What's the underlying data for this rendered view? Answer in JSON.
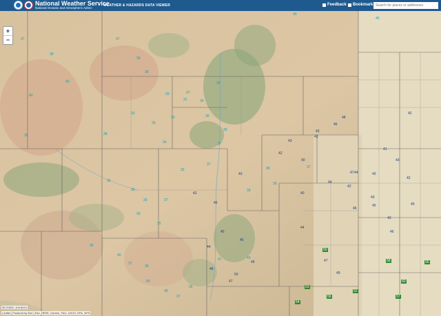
{
  "header": {
    "brand_title": "National Weather Service",
    "brand_subtitle": "National Oceanic and Atmospheric Admin",
    "app_title": "WEATHER & HAZARDS DATA VIEWER",
    "feedback_label": "Feedback",
    "bookmark_label": "Bookmark",
    "search_placeholder": "Search for places or addresses",
    "bg_color": "#1f5a8f"
  },
  "map": {
    "zoom_in": "+",
    "zoom_out": "−",
    "coord_readout": "35.21963 -104.8410",
    "attribution": "Leaflet | Powered by Esri | Esri, HERE, Garmin, FAO, USGS, EPA, NPS",
    "colors": {
      "teal": "#11a3b8",
      "blue": "#1b3f86",
      "green_box": "#2e8a2e"
    }
  },
  "stations": [
    {
      "v": "40",
      "c": "warm"
    },
    {
      "v": "46",
      "c": "warm"
    },
    {
      "v": "37",
      "c": "warm"
    },
    {
      "v": "37",
      "c": "warm"
    },
    {
      "v": "38",
      "c": "warm"
    },
    {
      "v": "39",
      "c": "warm"
    },
    {
      "v": "38",
      "c": "warm"
    },
    {
      "v": "40",
      "c": "warm"
    },
    {
      "v": "37",
      "c": "warm"
    },
    {
      "v": "35",
      "c": "warm"
    },
    {
      "v": "40",
      "c": "warm"
    },
    {
      "v": "33",
      "c": "warm"
    },
    {
      "v": "33",
      "c": "warm"
    },
    {
      "v": "29",
      "c": "warm"
    },
    {
      "v": "30",
      "c": "warm"
    },
    {
      "v": "36",
      "c": "warm"
    },
    {
      "v": "38",
      "c": "warm"
    },
    {
      "v": "34",
      "c": "warm"
    },
    {
      "v": "37",
      "c": "warm"
    },
    {
      "v": "32",
      "c": "warm"
    },
    {
      "v": "36",
      "c": "warm"
    },
    {
      "v": "35",
      "c": "warm"
    },
    {
      "v": "39",
      "c": "warm"
    },
    {
      "v": "37",
      "c": "warm"
    },
    {
      "v": "39",
      "c": "warm"
    },
    {
      "v": "35",
      "c": "warm"
    },
    {
      "v": "36",
      "c": "warm"
    },
    {
      "v": "40",
      "c": "warm"
    },
    {
      "v": "37",
      "c": "warm"
    },
    {
      "v": "38",
      "c": "warm"
    },
    {
      "v": "43",
      "c": "hot"
    },
    {
      "v": "39",
      "c": "warm"
    },
    {
      "v": "39",
      "c": "warm"
    },
    {
      "v": "40",
      "c": "hot"
    },
    {
      "v": "43",
      "c": "hot"
    },
    {
      "v": "42",
      "c": "hot"
    },
    {
      "v": "43",
      "c": "hot"
    },
    {
      "v": "37",
      "c": "warm"
    },
    {
      "v": "38",
      "c": "warm"
    },
    {
      "v": "40",
      "c": "hot"
    },
    {
      "v": "44",
      "c": "hot"
    },
    {
      "v": "46",
      "c": "hot"
    },
    {
      "v": "43",
      "c": "hot"
    },
    {
      "v": "48",
      "c": "hot"
    },
    {
      "v": "42",
      "c": "hot"
    },
    {
      "v": "44",
      "c": "hot"
    },
    {
      "v": "45",
      "c": "hot"
    },
    {
      "v": "47",
      "c": "hot"
    },
    {
      "v": "43",
      "c": "hot"
    },
    {
      "v": "46",
      "c": "hot"
    },
    {
      "v": "40",
      "c": "hot"
    },
    {
      "v": "42",
      "c": "hot"
    },
    {
      "v": "45",
      "c": "hot"
    },
    {
      "v": "46",
      "c": "hot"
    },
    {
      "v": "47",
      "c": "hot"
    },
    {
      "v": "49",
      "c": "hot"
    },
    {
      "v": "50",
      "c": "boxed"
    },
    {
      "v": "52",
      "c": "boxed"
    },
    {
      "v": "54",
      "c": "boxed"
    },
    {
      "v": "53",
      "c": "boxed"
    },
    {
      "v": "56",
      "c": "boxed"
    },
    {
      "v": "58",
      "c": "boxed"
    },
    {
      "v": "60",
      "c": "boxed"
    },
    {
      "v": "55",
      "c": "boxed"
    },
    {
      "v": "57",
      "c": "boxed"
    },
    {
      "v": "44",
      "c": "hot"
    },
    {
      "v": "40",
      "c": "hot"
    },
    {
      "v": "41",
      "c": "hot"
    },
    {
      "v": "43",
      "c": "hot"
    },
    {
      "v": "42",
      "c": "hot"
    },
    {
      "v": "36",
      "c": "warm"
    },
    {
      "v": "37",
      "c": "warm"
    },
    {
      "v": "38",
      "c": "warm"
    },
    {
      "v": "40",
      "c": "warm"
    },
    {
      "v": "44",
      "c": "hot"
    },
    {
      "v": "45",
      "c": "hot"
    },
    {
      "v": "48",
      "c": "hot"
    },
    {
      "v": "47",
      "c": "hot"
    },
    {
      "v": "41",
      "c": "warm"
    },
    {
      "v": "43",
      "c": "warm"
    },
    {
      "v": "33",
      "c": "warm"
    },
    {
      "v": "31",
      "c": "warm"
    },
    {
      "v": "34",
      "c": "warm"
    },
    {
      "v": "39",
      "c": "warm"
    },
    {
      "v": "37",
      "c": "warm"
    },
    {
      "v": "42",
      "c": "hot"
    },
    {
      "v": "46",
      "c": "hot"
    },
    {
      "v": "45",
      "c": "hot"
    },
    {
      "v": "49",
      "c": "hot"
    },
    {
      "v": "50",
      "c": "hot"
    }
  ]
}
